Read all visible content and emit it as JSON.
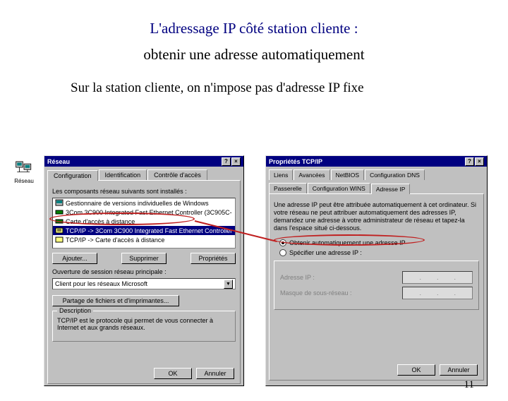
{
  "heading": {
    "line1": "L'adressage IP côté station cliente :",
    "line2": "obtenir une adresse automatiquement"
  },
  "subtitle": "Sur la station cliente, on n'impose pas d'adresse IP fixe",
  "desktop_icon": {
    "label": "Réseau"
  },
  "reseau_window": {
    "title": "Réseau",
    "help_btn": "?",
    "close_btn": "×",
    "tabs": [
      "Configuration",
      "Identification",
      "Contrôle d'accès"
    ],
    "components_label": "Les composants réseau suivants sont installés :",
    "components": [
      "Gestionnaire de versions individuelles de Windows",
      "3Com 3C900 Integrated Fast Ethernet Controller (3C905C-",
      "Carte d'accès à distance",
      "TCP/IP -> 3Com 3C900 Integrated Fast Ethernet Controller",
      "TCP/IP -> Carte d'accès à distance"
    ],
    "btn_add": "Ajouter...",
    "btn_remove": "Supprimer",
    "btn_props": "Propriétés",
    "logon_label": "Ouverture de session réseau principale :",
    "logon_value": "Client pour les réseaux Microsoft",
    "share_btn": "Partage de fichiers et d'imprimantes...",
    "desc_legend": "Description",
    "desc_text": "TCP/IP est le protocole qui permet de vous connecter à Internet et aux grands réseaux.",
    "btn_ok": "OK",
    "btn_cancel": "Annuler"
  },
  "tcpip_window": {
    "title": "Propriétés TCP/IP",
    "help_btn": "?",
    "close_btn": "×",
    "tabs_row1": [
      "Liens",
      "Avancées",
      "NetBIOS",
      "Configuration DNS"
    ],
    "tabs_row2": [
      "Passerelle",
      "Configuration WINS",
      "Adresse IP"
    ],
    "instructions": "Une adresse IP peut être attribuée automatiquement à cet ordinateur. Si votre réseau ne peut attribuer automatiquement des adresses IP, demandez une adresse à votre administrateur de réseau et tapez-la dans l'espace situé ci-dessous.",
    "radio_auto": "Obtenir automatiquement une adresse IP",
    "radio_specify": "Spécifier une adresse IP :",
    "ip_label": "Adresse IP :",
    "mask_label": "Masque de sous-réseau :",
    "btn_ok": "OK",
    "btn_cancel": "Annuler"
  },
  "page_number": "11"
}
